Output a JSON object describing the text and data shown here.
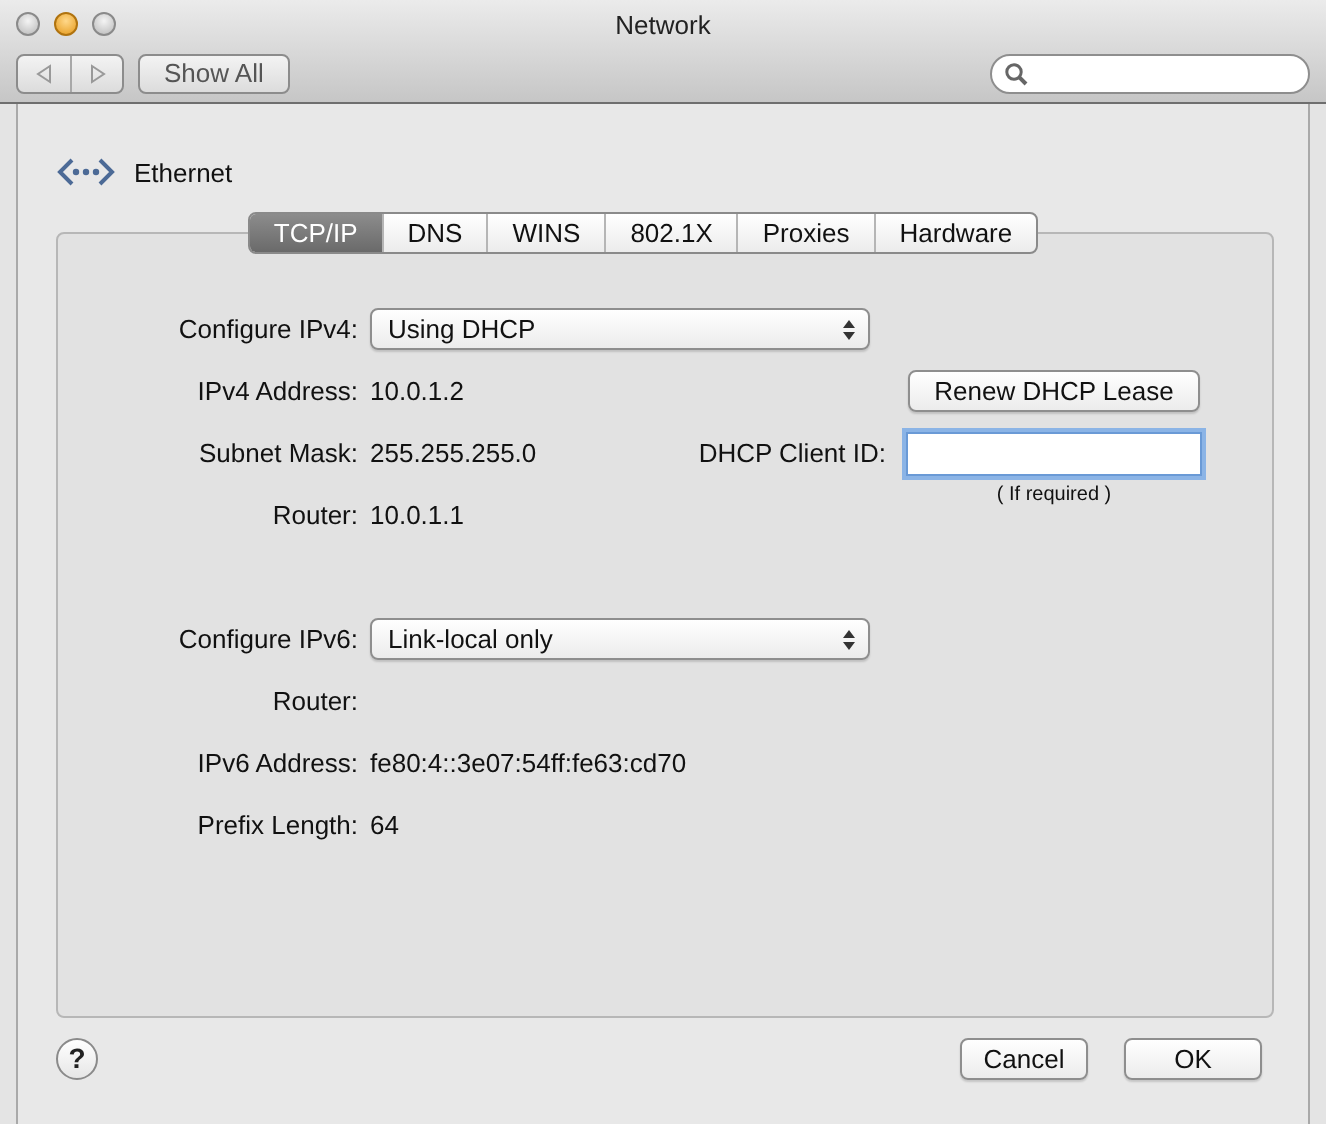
{
  "window": {
    "title": "Network"
  },
  "toolbar": {
    "show_all": "Show All"
  },
  "service": {
    "name": "Ethernet"
  },
  "tabs": [
    {
      "label": "TCP/IP",
      "selected": true
    },
    {
      "label": "DNS",
      "selected": false
    },
    {
      "label": "WINS",
      "selected": false
    },
    {
      "label": "802.1X",
      "selected": false
    },
    {
      "label": "Proxies",
      "selected": false
    },
    {
      "label": "Hardware",
      "selected": false
    }
  ],
  "ipv4": [
    {
      "kind": "popup",
      "label": "Configure IPv4:",
      "value": "Using DHCP"
    },
    {
      "kind": "value",
      "label": "IPv4 Address:",
      "value": "10.0.1.2",
      "aside": {
        "kind": "button",
        "label": "Renew DHCP Lease"
      }
    },
    {
      "kind": "value",
      "label": "Subnet Mask:",
      "value": "255.255.255.0",
      "aside": {
        "kind": "field",
        "label": "DHCP Client ID:"
      }
    },
    {
      "kind": "value",
      "label": "Router:",
      "value": "10.0.1.1",
      "aside": {
        "kind": "hint",
        "label": "( If required )"
      }
    }
  ],
  "ipv6": [
    {
      "kind": "popup",
      "label": "Configure IPv6:",
      "value": "Link-local only"
    },
    {
      "kind": "value",
      "label": "Router:"
    },
    {
      "kind": "value",
      "label": "IPv6 Address:",
      "value": "fe80:4::3e07:54ff:fe63:cd70"
    },
    {
      "kind": "value",
      "label": "Prefix Length:",
      "value": "64"
    }
  ],
  "buttons": {
    "help": "?",
    "cancel": "Cancel",
    "ok": "OK"
  }
}
